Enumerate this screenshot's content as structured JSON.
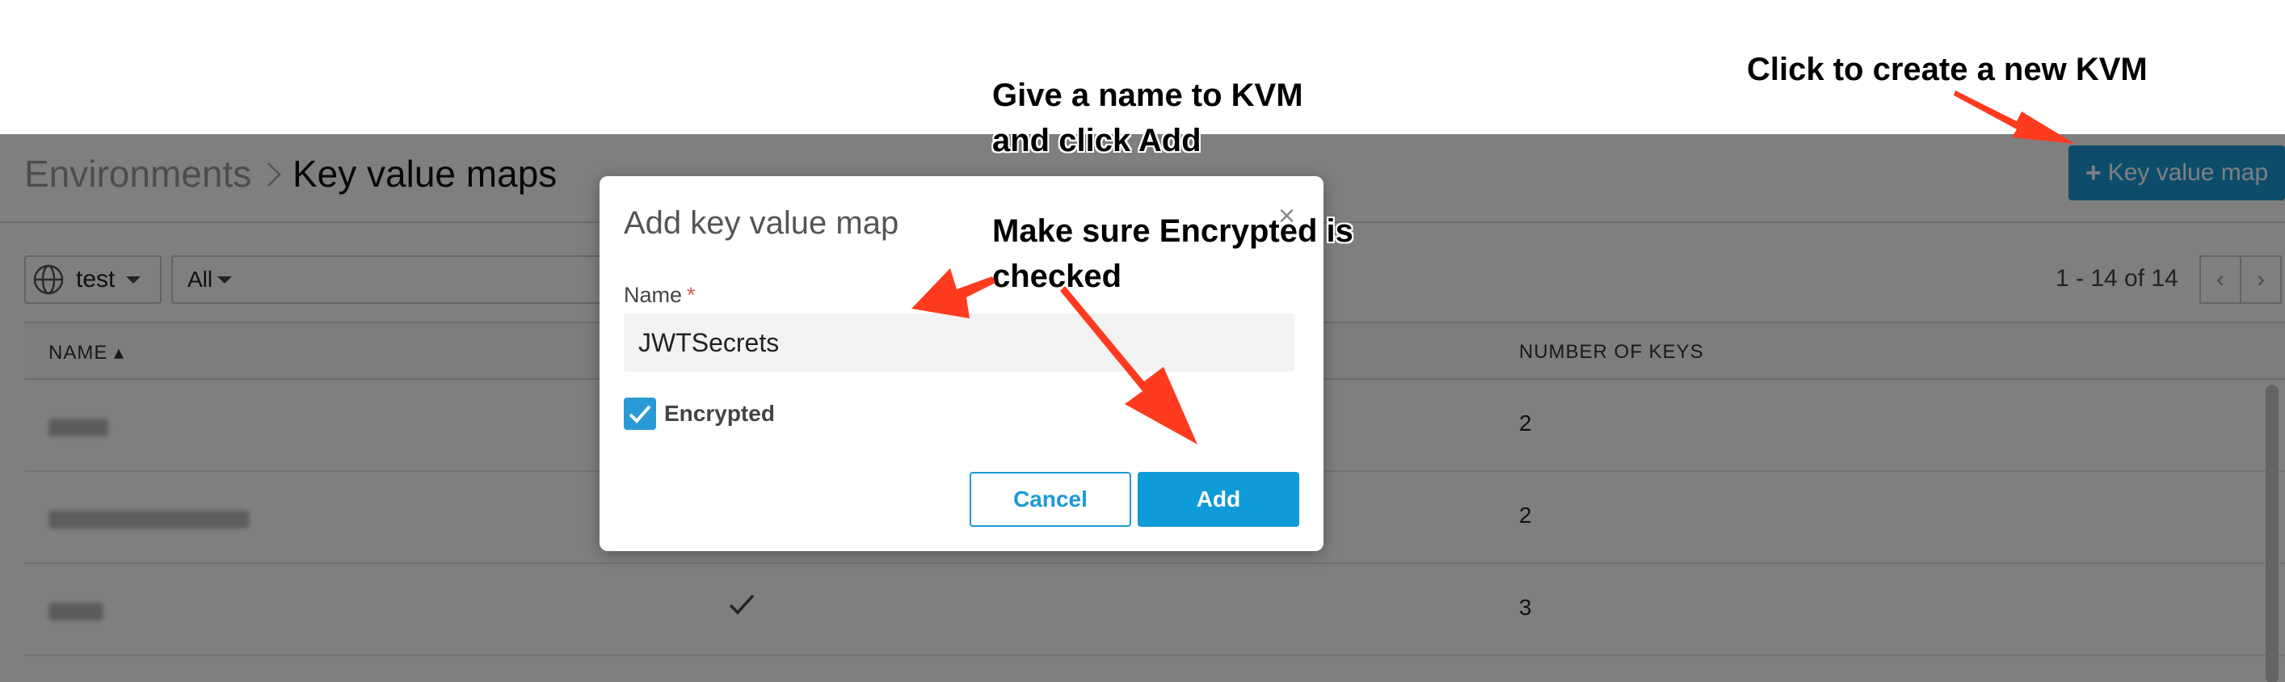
{
  "breadcrumb": {
    "parent": "Environments",
    "current": "Key value maps"
  },
  "header": {
    "add_kvm_button": "Key value map",
    "add_icon": "+"
  },
  "toolbar": {
    "environment": "test",
    "filter_scope": "All",
    "filter_value": "",
    "pagination": "1 - 14 of 14",
    "prev_icon": "‹",
    "next_icon": "›"
  },
  "table": {
    "columns": {
      "name": "NAME ▴",
      "keys": "NUMBER OF KEYS"
    },
    "rows": [
      {
        "keys": "2",
        "encrypted": false
      },
      {
        "keys": "2",
        "encrypted": false
      },
      {
        "keys": "3",
        "encrypted": true
      }
    ]
  },
  "modal": {
    "title": "Add key value map",
    "close": "×",
    "name_label": "Name",
    "required_marker": "*",
    "name_value": "JWTSecrets",
    "encrypted_label": "Encrypted",
    "encrypted_checked": true,
    "cancel_label": "Cancel",
    "add_label": "Add"
  },
  "annotations": {
    "create_kvm": "Click to create a new KVM",
    "name_line1": "Give a name to KVM",
    "name_line2": "and click Add",
    "encrypted_line1": "Make sure Encrypted is",
    "encrypted_line2": "checked"
  },
  "colors": {
    "accent": "#1a9ad6",
    "arrow": "#ff3b1f",
    "overlay": "rgba(0,0,0,0.5)"
  }
}
